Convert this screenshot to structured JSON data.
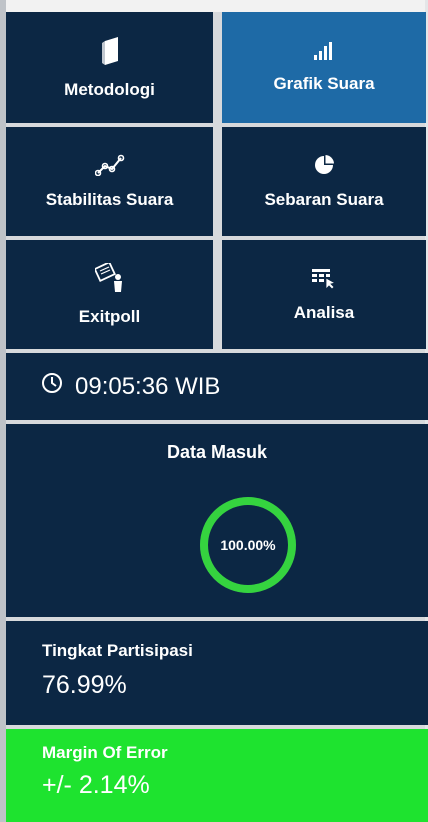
{
  "menu": [
    {
      "key": "metodologi",
      "label": "Metodologi",
      "icon": "book-icon",
      "active": false
    },
    {
      "key": "grafik-suara",
      "label": "Grafik Suara",
      "icon": "bar-chart-icon",
      "active": true
    },
    {
      "key": "stabilitas-suara",
      "label": "Stabilitas Suara",
      "icon": "line-graph-icon",
      "active": false
    },
    {
      "key": "sebaran-suara",
      "label": "Sebaran Suara",
      "icon": "pie-chart-icon",
      "active": false
    },
    {
      "key": "exitpoll",
      "label": "Exitpoll",
      "icon": "presenter-icon",
      "active": false
    },
    {
      "key": "analisa",
      "label": "Analisa",
      "icon": "table-cursor-icon",
      "active": false
    }
  ],
  "clock": {
    "time": "09:05:36 WIB",
    "icon": "clock-icon"
  },
  "data_masuk": {
    "title": "Data Masuk",
    "percent_text": "100.00%",
    "fraction": 1.0,
    "ring_color": "#35d33f"
  },
  "partisipasi": {
    "label": "Tingkat Partisipasi",
    "value": "76.99%"
  },
  "margin_error": {
    "label": "Margin Of Error",
    "value": "+/- 2.14%",
    "color": "#1ee32f"
  },
  "colors": {
    "tile": "#0c2744",
    "tile_active": "#1e6aa6",
    "page": "#d7d9dc"
  }
}
